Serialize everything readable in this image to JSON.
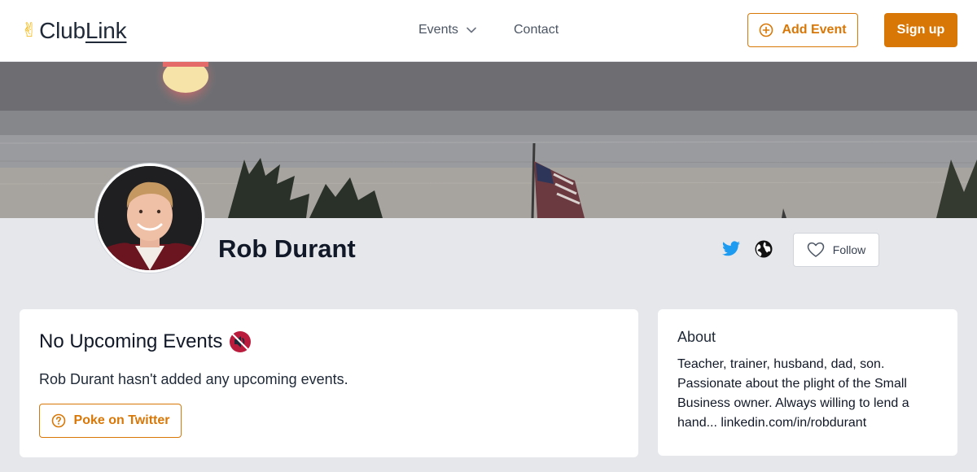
{
  "header": {
    "logo_emoji": "✌",
    "logo_text_club": "Club",
    "logo_text_link": "Link",
    "nav": {
      "events_label": "Events",
      "contact_label": "Contact"
    },
    "add_event_label": "Add Event",
    "signup_label": "Sign up"
  },
  "profile": {
    "name": "Rob Durant",
    "follow_label": "Follow",
    "social_icons": [
      "twitter-icon",
      "globe-icon"
    ]
  },
  "events_card": {
    "title": "No Upcoming Events",
    "title_emoji": "🔇",
    "description": "Rob Durant hasn't added any upcoming events.",
    "poke_label": "Poke on Twitter"
  },
  "about_card": {
    "title": "About",
    "text": "Teacher, trainer, husband, dad, son. Passionate about the plight of the Small Business owner. Always willing to lend a hand... linkedin.com/in/robdurant"
  },
  "colors": {
    "accent": "#d97706",
    "twitter": "#1d9bf0",
    "page_bg": "#e5e7eb"
  }
}
